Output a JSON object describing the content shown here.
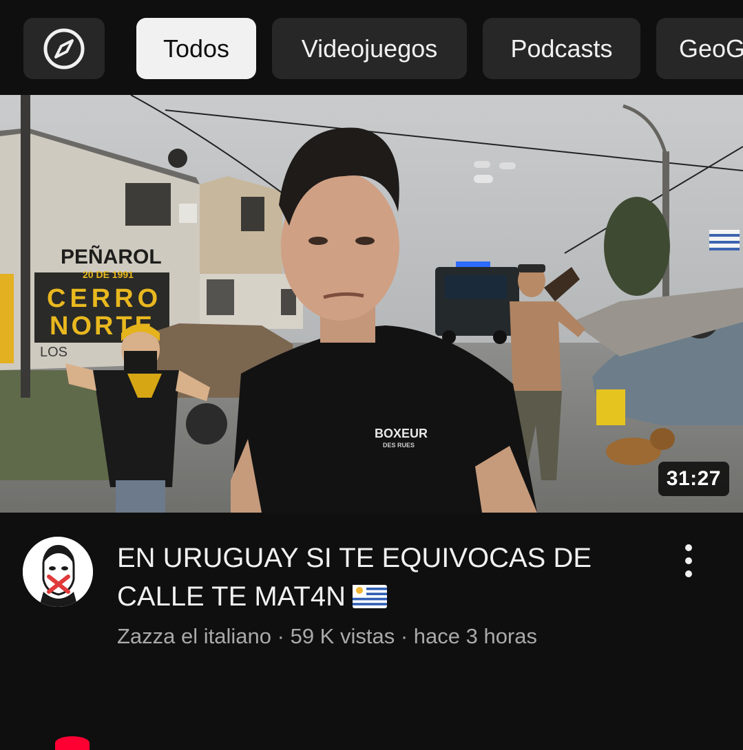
{
  "chips": [
    {
      "label": "Todos",
      "active": true
    },
    {
      "label": "Videojuegos",
      "active": false
    },
    {
      "label": "Podcasts",
      "active": false
    },
    {
      "label": "GeoG",
      "active": false
    }
  ],
  "explore_icon": "compass-icon",
  "video": {
    "duration": "31:27",
    "title": "EN URUGUAY SI TE EQUIVOCAS DE CALLE TE MAT4N",
    "title_flag": "uruguay-flag-icon",
    "channel": "Zazza el italiano",
    "views": "59 K vistas",
    "age": "hace 3 horas",
    "separator": " · ",
    "thumbnail_texts": {
      "wall_top": "PEÑAROL",
      "wall_date": "20 DE 1991",
      "wall_main_1": "CERRO",
      "wall_main_2": "NORTE",
      "wall_bottom": "LOS",
      "shirt_logo": "BOXEUR",
      "shirt_sub": "DES RUES"
    }
  },
  "colors": {
    "background": "#0f0f0f",
    "chip": "#272727",
    "chip_active": "#f1f1f1",
    "secondary_text": "#aaaaaa"
  }
}
